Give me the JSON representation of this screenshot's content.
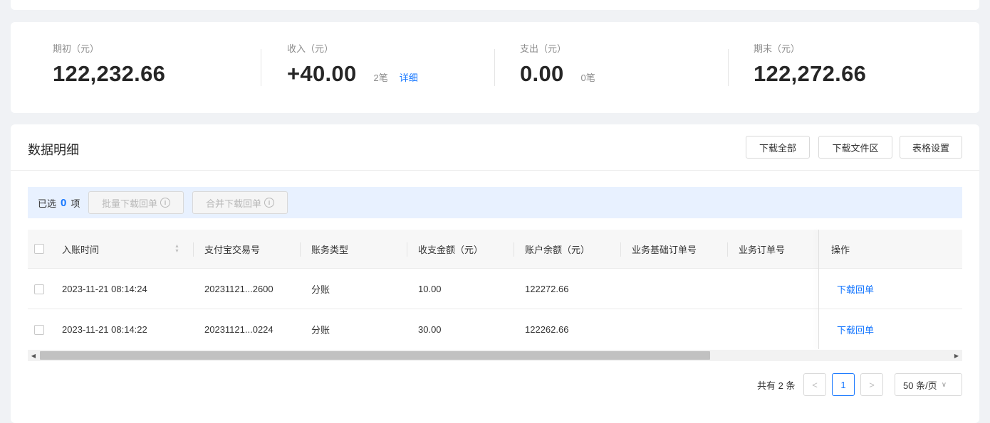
{
  "summary": {
    "opening": {
      "label": "期初（元）",
      "value": "122,232.66"
    },
    "income": {
      "label": "收入（元）",
      "value": "+40.00",
      "count": "2笔",
      "detail": "详细"
    },
    "expense": {
      "label": "支出（元）",
      "value": "0.00",
      "count": "0笔"
    },
    "closing": {
      "label": "期末（元）",
      "value": "122,272.66"
    }
  },
  "detail": {
    "title": "数据明细",
    "buttons": {
      "download_all": "下载全部",
      "download_files": "下载文件区",
      "table_settings": "表格设置"
    }
  },
  "selection": {
    "prefix": "已选",
    "count": "0",
    "suffix": "项",
    "batch_download": "批量下载回单",
    "merge_download": "合并下载回单"
  },
  "table": {
    "headers": [
      "入账时间",
      "支付宝交易号",
      "账务类型",
      "收支金额（元）",
      "账户余额（元）",
      "业务基础订单号",
      "业务订单号",
      "操作"
    ],
    "rows": [
      {
        "time": "2023-11-21 08:14:24",
        "trade_no": "20231121...2600",
        "type": "分账",
        "amount": "10.00",
        "balance": "122272.66",
        "base_order": "",
        "order": "",
        "action": "下载回单"
      },
      {
        "time": "2023-11-21 08:14:22",
        "trade_no": "20231121...0224",
        "type": "分账",
        "amount": "30.00",
        "balance": "122262.66",
        "base_order": "",
        "order": "",
        "action": "下载回单"
      }
    ]
  },
  "pagination": {
    "total": "共有 2 条",
    "current_page": "1",
    "page_size": "50 条/页"
  },
  "colors": {
    "accent": "#1677ff",
    "selection_bg": "#e8f1ff",
    "page_bg": "#f0f2f5"
  }
}
